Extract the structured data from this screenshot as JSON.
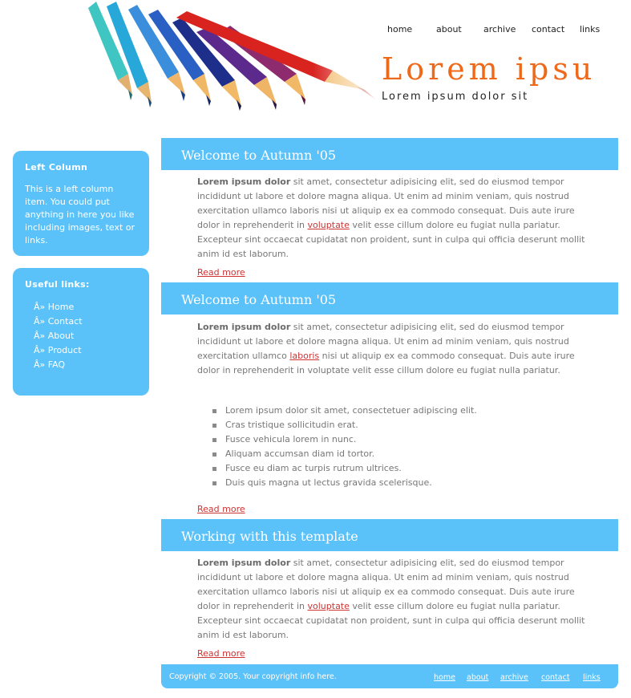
{
  "nav": {
    "home": "home",
    "about": "about",
    "archive": "archive",
    "contact": "contact",
    "links": "links"
  },
  "logo": {
    "title": "Lorem ipsu",
    "subtitle": "Lorem ipsum dolor sit"
  },
  "colors": {
    "accent": "#5ac2f9",
    "title": "#ee6a1a",
    "link": "#cc3333"
  },
  "left_column": {
    "heading": "Left Column",
    "text": "This is a left column item. You could put anything in here you like including images, text or links."
  },
  "useful_links": {
    "heading": "Useful links:",
    "items": [
      {
        "label": "Â» Home"
      },
      {
        "label": "Â» Contact"
      },
      {
        "label": "Â» About"
      },
      {
        "label": "Â» Product"
      },
      {
        "label": "Â» FAQ"
      }
    ]
  },
  "sections": [
    {
      "title": "Welcome to Autumn '05",
      "bold": "Lorem ipsum dolor",
      "text_a": " sit amet, consectetur adipisicing elit, sed do eiusmod tempor incididunt ut labore et dolore magna aliqua. Ut enim ad minim veniam, quis nostrud exercitation ullamco laboris nisi ut aliquip ex ea commodo consequat. Duis aute irure dolor in reprehenderit in ",
      "link": "voluptate",
      "text_b": " velit esse cillum dolore eu fugiat nulla pariatur. Excepteur sint occaecat cupidatat non proident, sunt in culpa qui officia deserunt mollit anim id est laborum.",
      "read_more": "Read more"
    },
    {
      "title": "Welcome to Autumn '05",
      "bold": "Lorem ipsum dolor",
      "text_a": " sit amet, consectetur adipisicing elit, sed do eiusmod tempor incididunt ut labore et dolore magna aliqua. Ut enim ad minim veniam, quis nostrud exercitation ullamco ",
      "link": "laboris",
      "text_b": " nisi ut aliquip ex ea commodo consequat. Duis aute irure dolor in reprehenderit in voluptate velit esse cillum dolore eu fugiat nulla pariatur.",
      "list": [
        "Lorem ipsum dolor sit amet, consectetuer adipiscing elit.",
        "Cras tristique sollicitudin erat.",
        "Fusce vehicula lorem in nunc.",
        "Aliquam accumsan diam id tortor.",
        "Fusce eu diam ac turpis rutrum ultrices.",
        "Duis quis magna ut lectus gravida scelerisque."
      ],
      "read_more": "Read more"
    },
    {
      "title": "Working with this template",
      "bold": "Lorem ipsum dolor",
      "text_a": " sit amet, consectetur adipisicing elit, sed do eiusmod tempor incididunt ut labore et dolore magna aliqua. Ut enim ad minim veniam, quis nostrud exercitation ullamco laboris nisi ut aliquip ex ea commodo consequat. Duis aute irure dolor in reprehenderit in ",
      "link": "voluptate",
      "text_b": " velit esse cillum dolore eu fugiat nulla pariatur. Excepteur sint occaecat cupidatat non proident, sunt in culpa qui officia deserunt mollit anim id est laborum.",
      "read_more": "Read more"
    }
  ],
  "footer": {
    "copyright": "Copyright © 2005. Your copyright info here.",
    "links": {
      "home": "home",
      "about": "about",
      "archive": "archive",
      "contact": "contact",
      "links": "links"
    }
  }
}
